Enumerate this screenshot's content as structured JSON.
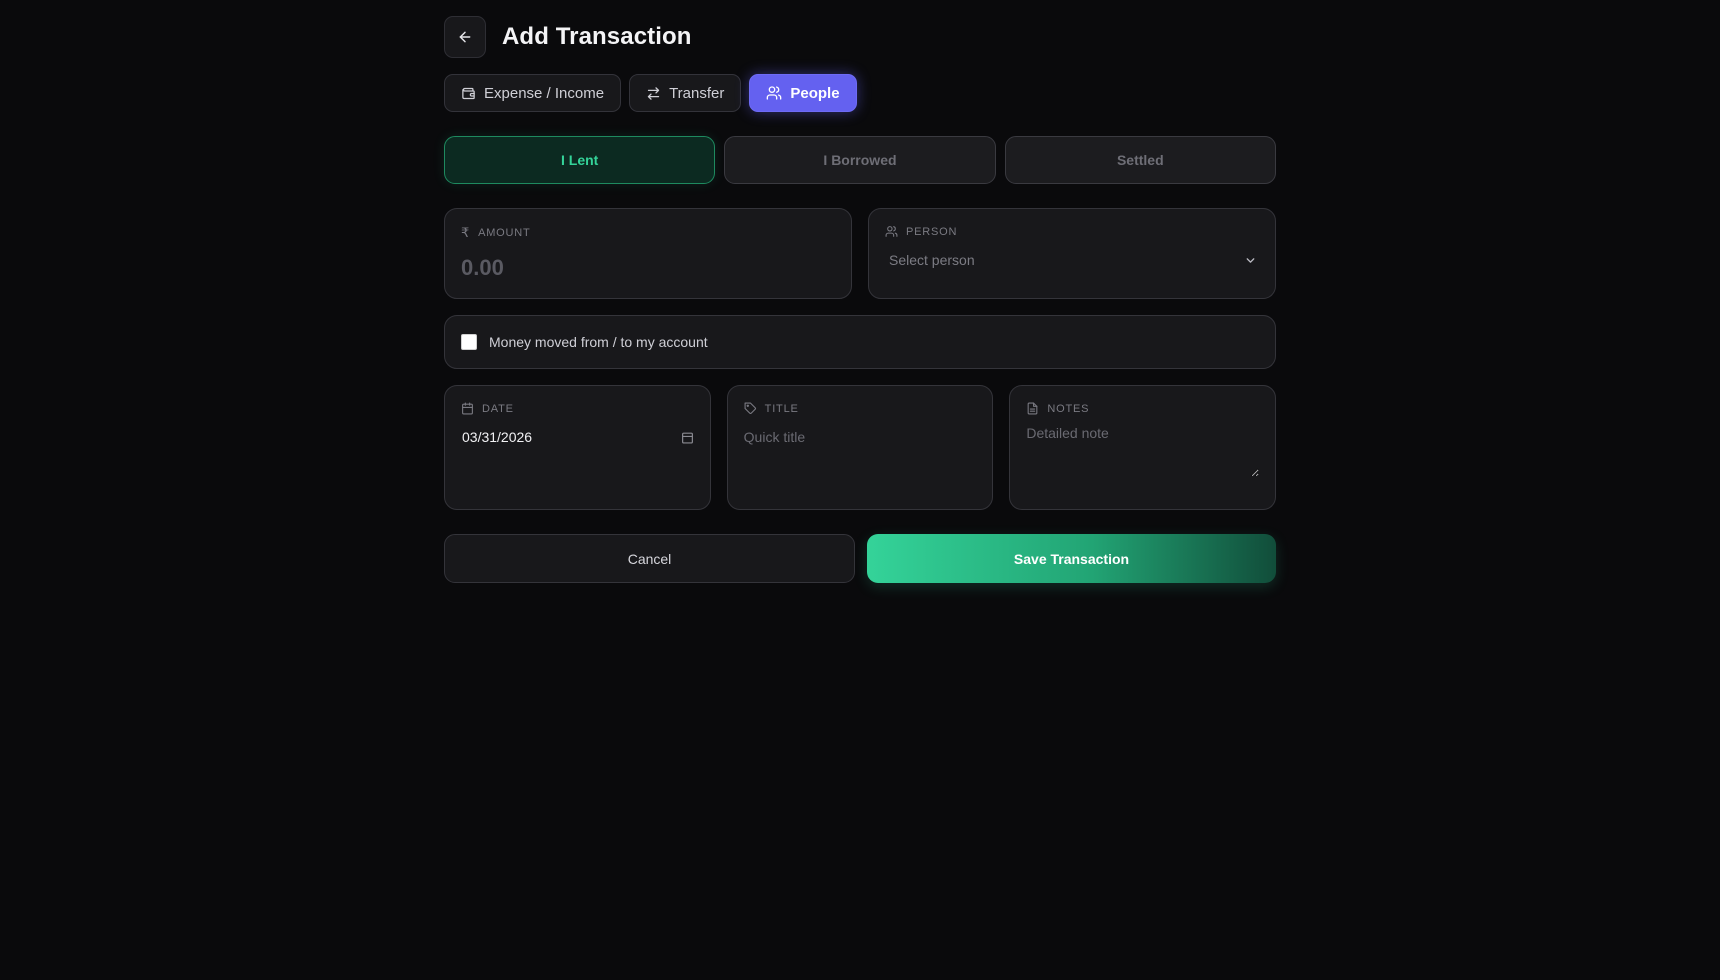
{
  "header": {
    "title": "Add Transaction",
    "back_icon": "arrow-left-icon"
  },
  "mode_tabs": [
    {
      "label": "Expense / Income",
      "icon": "wallet-icon",
      "active": false
    },
    {
      "label": "Transfer",
      "icon": "arrows-swap-icon",
      "active": false
    },
    {
      "label": "People",
      "icon": "users-icon",
      "active": true
    }
  ],
  "direction_options": [
    {
      "label": "I Lent",
      "active": true
    },
    {
      "label": "I Borrowed",
      "active": false
    },
    {
      "label": "Settled",
      "active": false
    }
  ],
  "amount": {
    "label": "AMOUNT",
    "currency_symbol": "₹",
    "placeholder": "0.00",
    "value": ""
  },
  "person": {
    "label": "PERSON",
    "placeholder": "Select person"
  },
  "account_checkbox": {
    "label": "Money moved from / to my account",
    "checked": false
  },
  "date": {
    "label": "DATE",
    "value": "03/31/2026"
  },
  "title_field": {
    "label": "TITLE",
    "placeholder": "Quick title"
  },
  "notes": {
    "label": "NOTES",
    "placeholder": "Detailed note"
  },
  "actions": {
    "cancel_label": "Cancel",
    "save_label": "Save Transaction"
  },
  "colors": {
    "background": "#0a0a0c",
    "accent_indigo": "#6461f0",
    "accent_green": "#34d399"
  }
}
